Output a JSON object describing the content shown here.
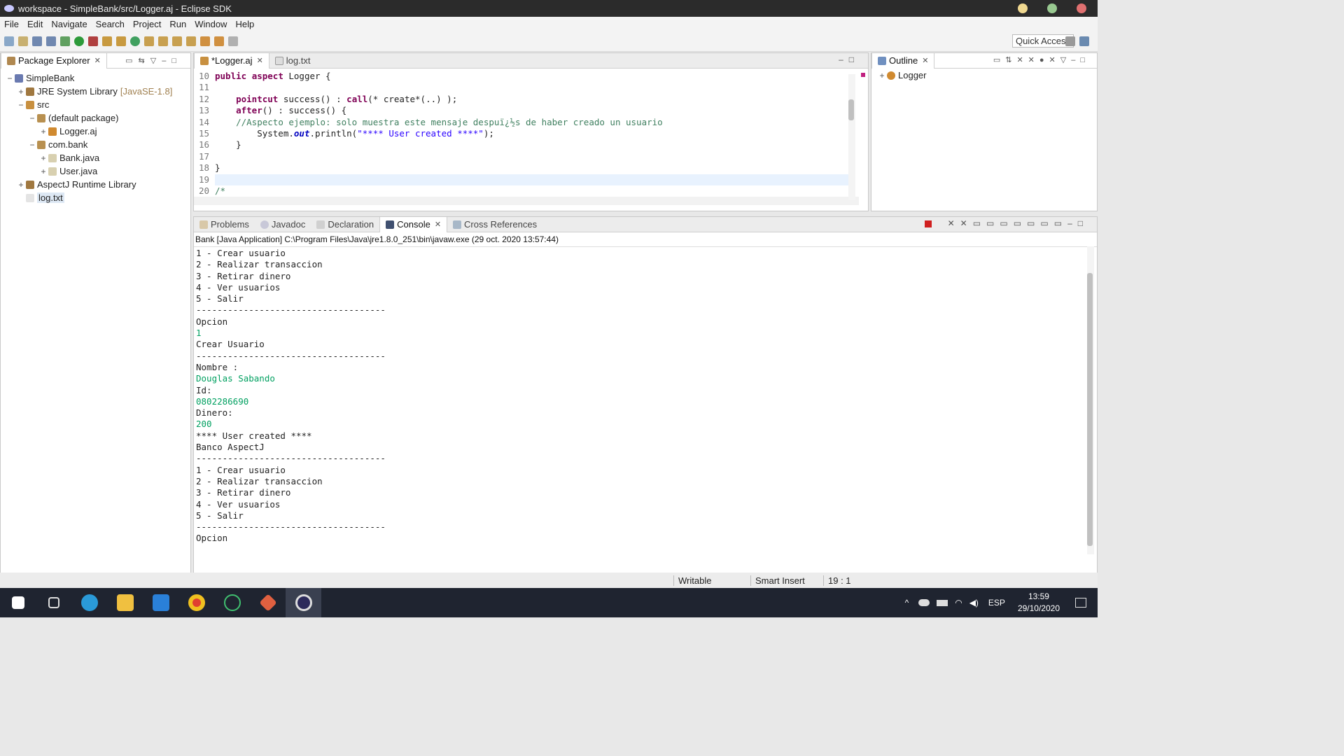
{
  "window": {
    "title": "workspace - SimpleBank/src/Logger.aj - Eclipse SDK"
  },
  "menu": [
    "File",
    "Edit",
    "Navigate",
    "Search",
    "Project",
    "Run",
    "Window",
    "Help"
  ],
  "toolbar": {
    "quick_access": "Quick Access"
  },
  "package_explorer": {
    "tab": "Package Explorer",
    "items": [
      {
        "label": "SimpleBank",
        "level": 0,
        "exp": "−",
        "icon": "project-icon"
      },
      {
        "label": "JRE System Library",
        "suffix": "[JavaSE-1.8]",
        "level": 1,
        "exp": "+",
        "icon": "library-icon"
      },
      {
        "label": "src",
        "level": 1,
        "exp": "−",
        "icon": "folder-icon"
      },
      {
        "label": "(default package)",
        "level": 2,
        "exp": "−",
        "icon": "package-icon"
      },
      {
        "label": "Logger.aj",
        "level": 3,
        "exp": "+",
        "icon": "aspect-file-icon"
      },
      {
        "label": "com.bank",
        "level": 2,
        "exp": "−",
        "icon": "package-icon"
      },
      {
        "label": "Bank.java",
        "level": 3,
        "exp": "+",
        "icon": "java-file-icon"
      },
      {
        "label": "User.java",
        "level": 3,
        "exp": "+",
        "icon": "java-file-icon"
      },
      {
        "label": "AspectJ Runtime Library",
        "level": 1,
        "exp": "+",
        "icon": "library-icon"
      },
      {
        "label": "log.txt",
        "level": 1,
        "exp": "",
        "icon": "text-file-icon"
      }
    ]
  },
  "editor": {
    "tabs": [
      {
        "label": "*Logger.aj"
      },
      {
        "label": "log.txt"
      }
    ],
    "lines": [
      {
        "n": "10",
        "html": "<span class=\"kw\">public</span> <span class=\"kw\">aspect</span> Logger {"
      },
      {
        "n": "11",
        "html": ""
      },
      {
        "n": "12",
        "html": "    <span class=\"kw\">pointcut</span> success() : <span class=\"kw\">call</span>(* create*(..) );"
      },
      {
        "n": "13",
        "html": "    <span class=\"kw\">after</span>() : success() {"
      },
      {
        "n": "14",
        "html": "    <span class=\"cm\">//Aspecto ejemplo: solo muestra este mensaje despuï¿½s de haber creado un usuario</span>"
      },
      {
        "n": "15",
        "html": "        System.<span class=\"out\">out</span>.println(<span class=\"st\">\"**** User created ****\"</span>);"
      },
      {
        "n": "16",
        "html": "    }"
      },
      {
        "n": "17",
        "html": ""
      },
      {
        "n": "18",
        "html": "}"
      },
      {
        "n": "19",
        "html": ""
      },
      {
        "n": "20",
        "html": "<span class=\"cm\">/*</span>"
      }
    ]
  },
  "outline": {
    "tab": "Outline",
    "items": [
      "Logger"
    ]
  },
  "bottom": {
    "tabs": [
      "Problems",
      "Javadoc",
      "Declaration",
      "Console",
      "Cross References"
    ],
    "header": "Bank [Java Application] C:\\Program Files\\Java\\jre1.8.0_251\\bin\\javaw.exe (29 oct. 2020 13:57:44)",
    "lines": [
      {
        "t": "1 - Crear usuario"
      },
      {
        "t": "2 - Realizar transaccion"
      },
      {
        "t": "3 - Retirar dinero"
      },
      {
        "t": "4 - Ver usuarios"
      },
      {
        "t": "5 - Salir"
      },
      {
        "t": "------------------------------------"
      },
      {
        "t": "Opcion"
      },
      {
        "t": "1",
        "input": true
      },
      {
        "t": "Crear Usuario"
      },
      {
        "t": "------------------------------------"
      },
      {
        "t": "Nombre :"
      },
      {
        "t": "Douglas Sabando",
        "input": true
      },
      {
        "t": "Id:"
      },
      {
        "t": "0802286690",
        "input": true
      },
      {
        "t": "Dinero:"
      },
      {
        "t": "200",
        "input": true
      },
      {
        "t": "**** User created ****"
      },
      {
        "t": "Banco AspectJ"
      },
      {
        "t": "------------------------------------"
      },
      {
        "t": "1 - Crear usuario"
      },
      {
        "t": "2 - Realizar transaccion"
      },
      {
        "t": "3 - Retirar dinero"
      },
      {
        "t": "4 - Ver usuarios"
      },
      {
        "t": "5 - Salir"
      },
      {
        "t": "------------------------------------"
      },
      {
        "t": "Opcion"
      }
    ]
  },
  "status": {
    "writable": "Writable",
    "insert": "Smart Insert",
    "position": "19 : 1"
  },
  "taskbar": {
    "lang": "ESP",
    "time": "13:59",
    "date": "29/10/2020"
  }
}
